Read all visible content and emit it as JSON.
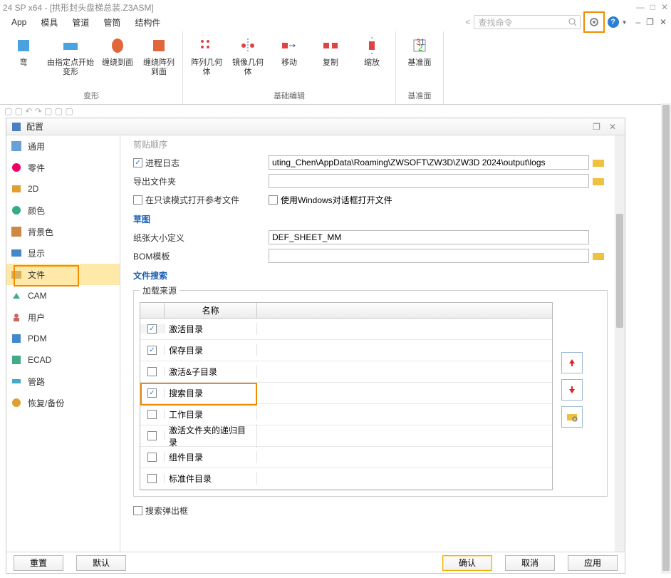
{
  "title": "24 SP x64 - [拱形封头盘梯总装.Z3ASM]",
  "menu": [
    "App",
    "模具",
    "管道",
    "管筒",
    "结构件"
  ],
  "search_placeholder": "查找命令",
  "ribbon": {
    "group1": {
      "name": "变形",
      "items": [
        "弯",
        "由指定点开始变形",
        "缠绕到面",
        "缠绕阵列到面"
      ]
    },
    "group2": {
      "name": "基础编辑",
      "items": [
        "阵列几何体",
        "镜像几何体",
        "移动",
        "复制",
        "缩放"
      ]
    },
    "group3": {
      "name": "基准面",
      "items": [
        "基准面"
      ]
    }
  },
  "dialog": {
    "title": "配置",
    "sidebar": [
      "通用",
      "零件",
      "2D",
      "颜色",
      "背景色",
      "显示",
      "文件",
      "CAM",
      "用户",
      "PDM",
      "ECAD",
      "管路",
      "恢复/备份"
    ],
    "active_index": 6,
    "clipped": "剪贴顺序",
    "rows": {
      "log": {
        "label": "进程日志",
        "checked": true,
        "value": "uting_Chen\\AppData\\Roaming\\ZWSOFT\\ZW3D\\ZW3D 2024\\output\\logs"
      },
      "export": {
        "label": "导出文件夹",
        "value": ""
      },
      "readonly": {
        "label": "在只读模式打开参考文件",
        "checked": false
      },
      "windlg": {
        "label": "使用Windows对话框打开文件",
        "checked": false
      }
    },
    "section_sketch": "草图",
    "paper": {
      "label": "纸张大小定义",
      "value": "DEF_SHEET_MM"
    },
    "bom": {
      "label": "BOM模板",
      "value": ""
    },
    "section_search": "文件搜索",
    "src_legend": "加载来源",
    "table": {
      "header": "名称",
      "rows": [
        {
          "label": "激活目录",
          "checked": true,
          "sel": true
        },
        {
          "label": "保存目录",
          "checked": true
        },
        {
          "label": "激活&子目录",
          "checked": false
        },
        {
          "label": "搜索目录",
          "checked": true,
          "hl": true
        },
        {
          "label": "工作目录",
          "checked": false
        },
        {
          "label": "激活文件夹的递归目录",
          "checked": false
        },
        {
          "label": "组件目录",
          "checked": false
        },
        {
          "label": "标准件目录",
          "checked": false
        }
      ]
    },
    "popframe": {
      "label": "搜索弹出框",
      "checked": false
    },
    "buttons": {
      "reset": "重置",
      "default": "默认",
      "ok": "确认",
      "cancel": "取消",
      "apply": "应用"
    }
  }
}
